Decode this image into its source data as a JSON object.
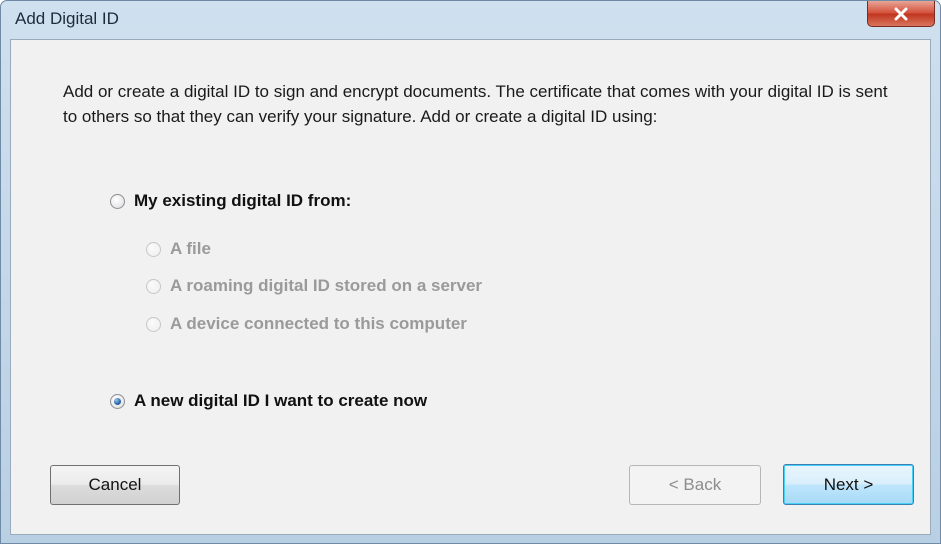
{
  "window": {
    "title": "Add Digital ID"
  },
  "description": "Add or create a digital ID to sign and encrypt documents. The certificate that comes with your digital ID is sent to others so that they can verify your signature. Add or create a digital ID using:",
  "options": {
    "existing": {
      "label": "My existing digital ID from:",
      "selected": false
    },
    "sub_options": [
      {
        "label": "A file",
        "enabled": false
      },
      {
        "label": "A roaming digital ID stored on a server",
        "enabled": false
      },
      {
        "label": "A device connected to this computer",
        "enabled": false
      }
    ],
    "new_id": {
      "label": "A new digital ID I want to create now",
      "selected": true
    }
  },
  "buttons": {
    "cancel": "Cancel",
    "back": "< Back",
    "next": "Next >"
  },
  "icons": {
    "close": "close-icon"
  },
  "colors": {
    "close_button": "#c8402b",
    "next_button_border": "#3c7fb1",
    "radio_selected": "#2b6db3",
    "disabled_text": "#9a9a9a"
  }
}
